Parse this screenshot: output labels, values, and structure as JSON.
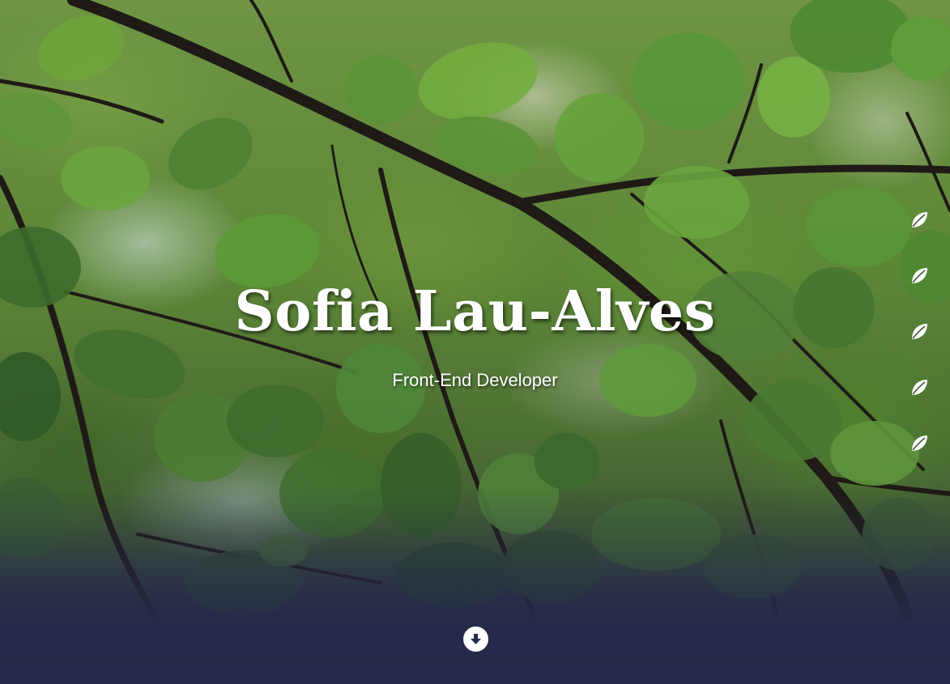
{
  "hero": {
    "name": "Sofia Lau-Alves",
    "role": "Front-End Developer",
    "background_icon": "foliage-background-image"
  },
  "side_nav": {
    "icon": "leaf-icon",
    "items": [
      {
        "icon": "leaf-icon"
      },
      {
        "icon": "leaf-icon"
      },
      {
        "icon": "leaf-icon"
      },
      {
        "icon": "leaf-icon"
      },
      {
        "icon": "leaf-icon"
      }
    ]
  },
  "scroll_button": {
    "icon": "arrow-down-circle-icon"
  },
  "colors": {
    "footer_band": "#262a4a",
    "text": "#ffffff",
    "leaf_green": "#5c8636"
  }
}
